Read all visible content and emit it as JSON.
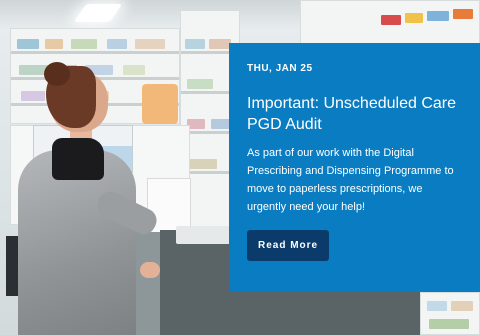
{
  "article": {
    "date": "THU, JAN 25",
    "title": "Important: Unscheduled Care PGD Audit",
    "body": "As part of our work with the Digital Prescribing and Dispensing Programme to move to paperless prescriptions, we urgently need your help!",
    "button_label": "Read More"
  },
  "colors": {
    "card": "#0a7cc2",
    "button": "#0b3b6b"
  },
  "image": {
    "description_icon": "pharmacy-photo"
  }
}
